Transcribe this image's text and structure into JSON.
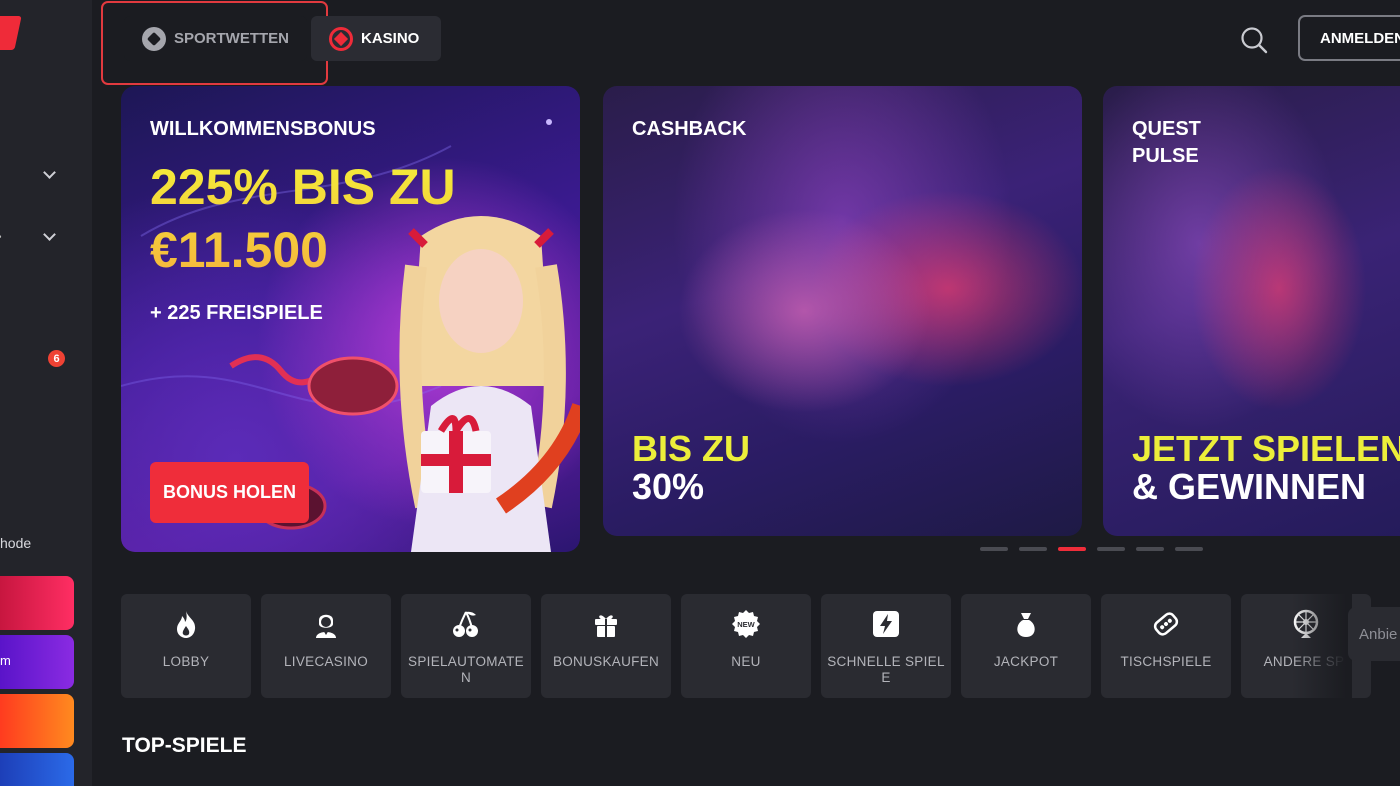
{
  "sidebar": {
    "badge_count": "6",
    "partial_text_1": "hode",
    "partial_text_2": "m",
    "card_colors": [
      "#e11d48",
      "#7c1ee3",
      "#ff4d1f",
      "#1d4ed8"
    ]
  },
  "header": {
    "tabs": [
      {
        "label": "SPORTWETTEN",
        "icon": "soccer-ball-icon"
      },
      {
        "label": "KASINO",
        "icon": "casino-chip-icon"
      }
    ],
    "login_label": "ANMELDEN",
    "search_icon": "search-icon"
  },
  "banners": [
    {
      "label": "WILLKOMMENSBONUS",
      "headline_1": "225% BIS ZU",
      "headline_2": "€11.500",
      "sub": "+ 225 FREISPIELE",
      "button": "BONUS HOLEN"
    },
    {
      "label": "CASHBACK",
      "highlight": "BIS ZU",
      "value": "30%"
    },
    {
      "label_1": "QUEST",
      "label_2": "PULSE",
      "highlight": "JETZT SPIELEN",
      "value": "& GEWINNEN"
    }
  ],
  "carousel": {
    "count": 6,
    "active_index": 2
  },
  "categories": [
    {
      "label": "LOBBY",
      "icon": "flame-icon"
    },
    {
      "label": "LIVECASINO",
      "icon": "dealer-icon"
    },
    {
      "label": "SPIELAUTOMATEN",
      "icon": "cherries-icon"
    },
    {
      "label": "BONUSKAUFEN",
      "icon": "gift-icon"
    },
    {
      "label": "NEU",
      "icon": "new-badge-icon"
    },
    {
      "label": "SCHNELLE SPIELE",
      "icon": "lightning-icon"
    },
    {
      "label": "JACKPOT",
      "icon": "money-bag-icon"
    },
    {
      "label": "TISCHSPIELE",
      "icon": "dice-icon"
    },
    {
      "label": "ANDERE SPI",
      "icon": "roulette-wheel-icon"
    }
  ],
  "provider_partial": "Anbie",
  "section_title": "TOP-SPIELE",
  "colors": {
    "accent": "#ef2d3a",
    "background": "#1b1c21",
    "yellow": "#ecee3a"
  }
}
